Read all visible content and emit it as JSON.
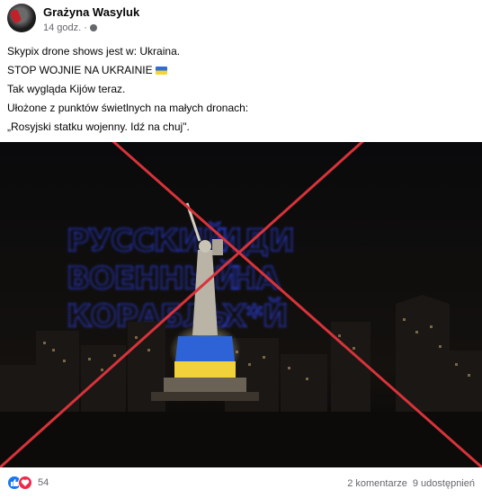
{
  "post": {
    "author": "Grażyna Wasyluk",
    "time": "14 godz.",
    "separator": "·",
    "text_lines": [
      "Skypix drone shows jest w: Ukraina.",
      "STOP WOJNIE NA UKRAINIE",
      "Tak wygląda Kijów teraz.",
      "Ułożone z punktów świetlnych na małych dronach:",
      "„Rosyjski statku wojenny. Idź na chuj\"."
    ],
    "flag_icon": "ukraine-flag-emoji"
  },
  "photo": {
    "drone_text_left": [
      "РУССКИЙ",
      "ВОЕННЫЙ",
      "КОРАБЛЬ"
    ],
    "drone_text_right": [
      "ИДИ",
      "НА",
      "Х*Й"
    ],
    "drone_color": "#2f45ff",
    "cross_color": "#d8333a"
  },
  "footer": {
    "reaction_icons": [
      "like-icon",
      "love-icon"
    ],
    "reaction_count": "54",
    "comments": "2 komentarze",
    "shares": "9 udostępnień"
  }
}
